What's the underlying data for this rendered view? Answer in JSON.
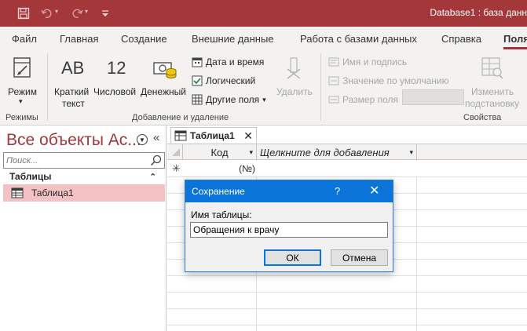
{
  "titlebar": {
    "title": "Database1 : база данн",
    "qat": [
      "save-icon",
      "undo-icon",
      "redo-icon",
      "customize-icon"
    ]
  },
  "tabs": [
    "Файл",
    "Главная",
    "Создание",
    "Внешние данные",
    "Работа с базами данных",
    "Справка",
    "Поля"
  ],
  "ribbon": {
    "views": {
      "label": "Режим",
      "group": "Режимы"
    },
    "add_delete": {
      "short_text_big": "AB",
      "short_text": "Краткий текст",
      "number_big": "12",
      "number": "Числовой",
      "currency": "Денежный",
      "datetime": "Дата и время",
      "yesno": "Логический",
      "more_fields": "Другие поля",
      "delete": "Удалить",
      "group": "Добавление и удаление"
    },
    "properties": {
      "name_caption": "Имя и подпись",
      "default_value": "Значение по умолчанию",
      "field_size": "Размер поля",
      "modify_lookups": "Изменить подстановку",
      "group": "Свойства"
    }
  },
  "nav": {
    "title": "Все объекты Ac...",
    "search_placeholder": "Поиск...",
    "section": "Таблицы",
    "items": [
      {
        "label": "Таблица1"
      }
    ]
  },
  "document": {
    "tab_label": "Таблица1",
    "columns": [
      "Код",
      "Щелкните для добавления"
    ],
    "new_row_marker": "✳",
    "new_row_id": "(№)"
  },
  "dialog": {
    "title": "Сохранение",
    "help": "?",
    "label": "Имя таблицы:",
    "value": "Обращения к врачу",
    "ok": "ОК",
    "cancel": "Отмена"
  }
}
